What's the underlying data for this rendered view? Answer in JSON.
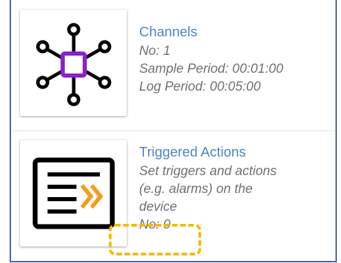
{
  "cards": [
    {
      "title": "Channels",
      "icon": "channels-network-icon",
      "lines": [
        "No: 1",
        "Sample Period: 00:01:00",
        "Log Period: 00:05:00"
      ]
    },
    {
      "title": "Triggered Actions",
      "icon": "triggered-actions-list-icon",
      "lines": [
        "Set triggers and actions",
        "(e.g. alarms) on the",
        "device",
        "No: 0"
      ]
    }
  ],
  "colors": {
    "title": "#4a86c8",
    "body_text": "#6f6f6f",
    "frame_border": "#3d5fb8",
    "hub_purple": "#8a22c9",
    "chevron_orange": "#f39c1f",
    "highlight": "#f6b800"
  }
}
